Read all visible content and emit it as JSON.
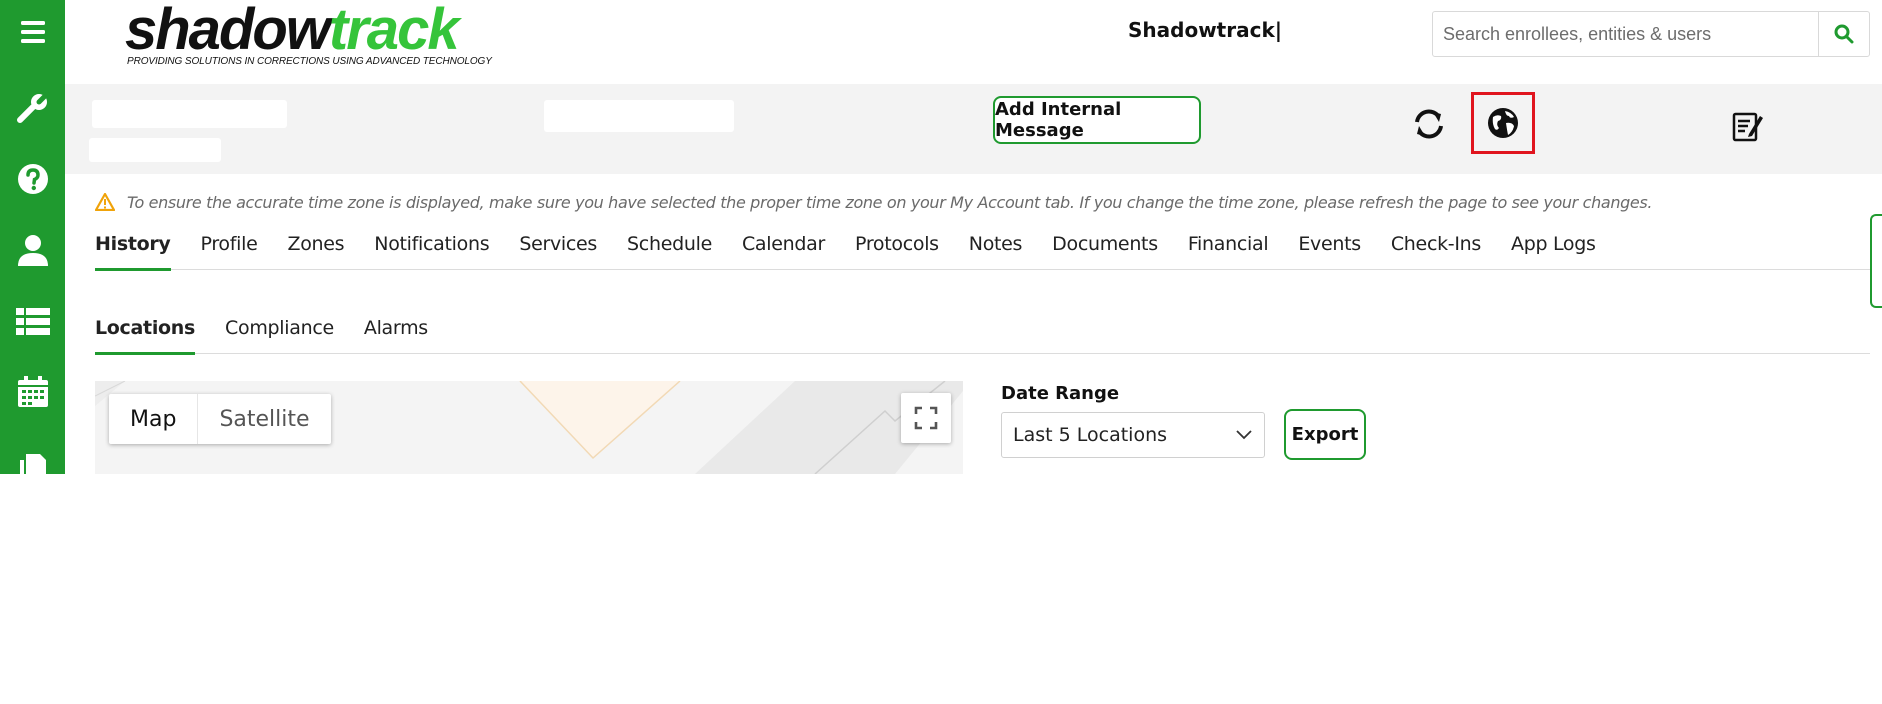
{
  "colors": {
    "brand_green": "#1f9a2f",
    "logo_green": "#35c43a",
    "highlight_red": "#e0141e",
    "warning_orange": "#f0a30a"
  },
  "sidebar": {
    "items": [
      {
        "icon": "hamburger-menu-icon"
      },
      {
        "icon": "wrench-icon"
      },
      {
        "icon": "help-circle-icon"
      },
      {
        "icon": "user-icon"
      },
      {
        "icon": "list-icon"
      },
      {
        "icon": "calendar-icon"
      },
      {
        "icon": "documents-icon"
      }
    ]
  },
  "header": {
    "logo": {
      "word1": "shadow",
      "word2": "track",
      "tagline": "PROVIDING SOLUTIONS IN CORRECTIONS USING ADVANCED TECHNOLOGY"
    },
    "app_title": "Shadowtrack|",
    "search": {
      "placeholder": "Search enrollees, entities & users",
      "value": "",
      "icon": "search-icon"
    }
  },
  "infobar": {
    "add_message_label": "Add Internal Message",
    "icons": [
      "refresh-icon",
      "globe-icon",
      "edit-note-icon"
    ]
  },
  "notice": {
    "icon": "warning-icon",
    "text": "To ensure the accurate time zone is displayed, make sure you have selected the proper time zone on your My Account tab. If you change the time zone, please refresh the page to see your changes."
  },
  "tabs": [
    {
      "label": "History",
      "active": true
    },
    {
      "label": "Profile"
    },
    {
      "label": "Zones"
    },
    {
      "label": "Notifications"
    },
    {
      "label": "Services"
    },
    {
      "label": "Schedule"
    },
    {
      "label": "Calendar"
    },
    {
      "label": "Protocols"
    },
    {
      "label": "Notes"
    },
    {
      "label": "Documents"
    },
    {
      "label": "Financial"
    },
    {
      "label": "Events"
    },
    {
      "label": "Check-Ins"
    },
    {
      "label": "App Logs"
    }
  ],
  "subtabs": [
    {
      "label": "Locations",
      "active": true
    },
    {
      "label": "Compliance"
    },
    {
      "label": "Alarms"
    }
  ],
  "map": {
    "type_options": [
      {
        "label": "Map",
        "active": true
      },
      {
        "label": "Satellite"
      }
    ],
    "fullscreen_icon": "fullscreen-icon"
  },
  "date_range": {
    "label": "Date Range",
    "selected": "Last 5 Locations",
    "export_label": "Export"
  }
}
